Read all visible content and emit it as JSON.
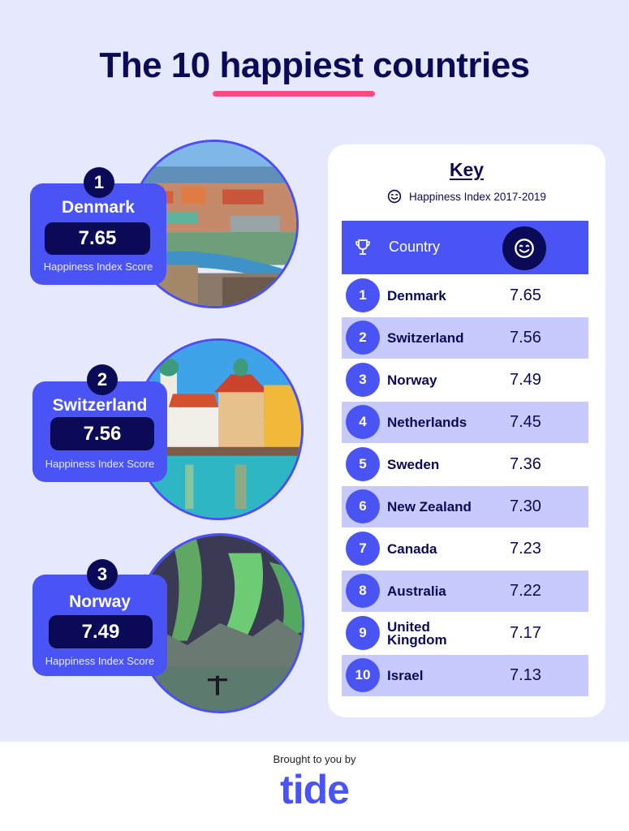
{
  "title": {
    "text": "The 10 happiest countries",
    "highlight_word": "happiest",
    "accent_color": "#ff4a7f"
  },
  "colors": {
    "background": "#e6e8fd",
    "primary_blue": "#4a54f5",
    "navy": "#0b0a57",
    "row_shade": "#c7cafc"
  },
  "featured": [
    {
      "rank": "1",
      "country": "Denmark",
      "score": "7.65",
      "caption": "Happiness Index Score",
      "photo": "copenhagen-cityscape"
    },
    {
      "rank": "2",
      "country": "Switzerland",
      "score": "7.56",
      "caption": "Happiness Index Score",
      "photo": "lucerne-waterfront"
    },
    {
      "rank": "3",
      "country": "Norway",
      "score": "7.49",
      "caption": "Happiness Index Score",
      "photo": "northern-lights"
    }
  ],
  "key": {
    "title": "Key",
    "legend_icon": "smiley-icon",
    "legend_text": "Happiness Index 2017-2019",
    "header": {
      "rank_icon": "trophy-icon",
      "country_label": "Country",
      "score_icon": "smiley-icon"
    },
    "rows": [
      {
        "rank": "1",
        "country": "Denmark",
        "score": "7.65"
      },
      {
        "rank": "2",
        "country": "Switzerland",
        "score": "7.56"
      },
      {
        "rank": "3",
        "country": "Norway",
        "score": "7.49"
      },
      {
        "rank": "4",
        "country": "Netherlands",
        "score": "7.45"
      },
      {
        "rank": "5",
        "country": "Sweden",
        "score": "7.36"
      },
      {
        "rank": "6",
        "country": "New Zealand",
        "score": "7.30"
      },
      {
        "rank": "7",
        "country": "Canada",
        "score": "7.23"
      },
      {
        "rank": "8",
        "country": "Australia",
        "score": "7.22"
      },
      {
        "rank": "9",
        "country": "United Kingdom",
        "score": "7.17"
      },
      {
        "rank": "10",
        "country": "Israel",
        "score": "7.13"
      }
    ]
  },
  "chart_data": {
    "type": "table",
    "title": "The 10 happiest countries",
    "subtitle": "Happiness Index 2017-2019",
    "columns": [
      "Rank",
      "Country",
      "Happiness Index Score"
    ],
    "categories": [
      "Denmark",
      "Switzerland",
      "Norway",
      "Netherlands",
      "Sweden",
      "New Zealand",
      "Canada",
      "Australia",
      "United Kingdom",
      "Israel"
    ],
    "values": [
      7.65,
      7.56,
      7.49,
      7.45,
      7.36,
      7.3,
      7.23,
      7.22,
      7.17,
      7.13
    ]
  },
  "footer": {
    "brought_by": "Brought to you by",
    "brand": "tide"
  }
}
